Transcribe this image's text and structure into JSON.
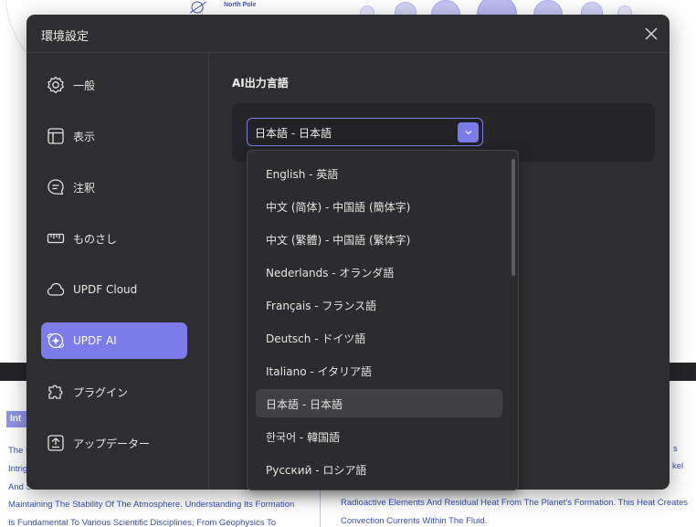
{
  "background_doc": {
    "diagram_label": "North Pole",
    "tag_text": "Int",
    "left_lines": [
      "The I",
      "Intrig",
      "And S",
      "Maintaining The Stability Of The Atmosphere. Understanding Its Formation",
      "Is Fundamental To Various Scientific Disciplines, From Geophysics To"
    ],
    "right_lines": [
      "s",
      "kel",
      "Radioactive Elements And Residual Heat From The Planet's Formation. This Heat Creates",
      "Convection Currents Within The Fluid."
    ]
  },
  "dialog": {
    "title": "環境設定",
    "close_icon": "close-icon"
  },
  "sidebar": {
    "items": [
      {
        "label": "一般",
        "icon": "gear-icon",
        "active": false
      },
      {
        "label": "表示",
        "icon": "layout-icon",
        "active": false
      },
      {
        "label": "注釈",
        "icon": "comment-icon",
        "active": false
      },
      {
        "label": "ものさし",
        "icon": "ruler-icon",
        "active": false
      },
      {
        "label": "UPDF Cloud",
        "icon": "cloud-icon",
        "active": false
      },
      {
        "label": "UPDF AI",
        "icon": "ai-icon",
        "active": true
      },
      {
        "label": "プラグイン",
        "icon": "puzzle-icon",
        "active": false
      },
      {
        "label": "アップデーター",
        "icon": "update-icon",
        "active": false
      }
    ]
  },
  "content": {
    "section_title": "AI出力言語",
    "select": {
      "value": "日本語 - 日本語",
      "arrow_icon": "chevron-down-icon"
    }
  },
  "dropdown": {
    "options": [
      {
        "label": "English - 英語",
        "selected": false
      },
      {
        "label": "中文 (简体) - 中国語 (簡体字)",
        "selected": false
      },
      {
        "label": "中文 (繁體) - 中国語 (繁体字)",
        "selected": false
      },
      {
        "label": "Nederlands - オランダ語",
        "selected": false
      },
      {
        "label": "Français - フランス語",
        "selected": false
      },
      {
        "label": "Deutsch - ドイツ語",
        "selected": false
      },
      {
        "label": "Italiano - イタリア語",
        "selected": false
      },
      {
        "label": "日本語 - 日本語",
        "selected": true
      },
      {
        "label": "한국어 - 韓国語",
        "selected": false
      },
      {
        "label": "Русский - ロシア語",
        "selected": false
      }
    ]
  },
  "colors": {
    "accent": "#7b7ce9",
    "modal_bg": "#2e2e30",
    "panel_bg": "#252527"
  }
}
